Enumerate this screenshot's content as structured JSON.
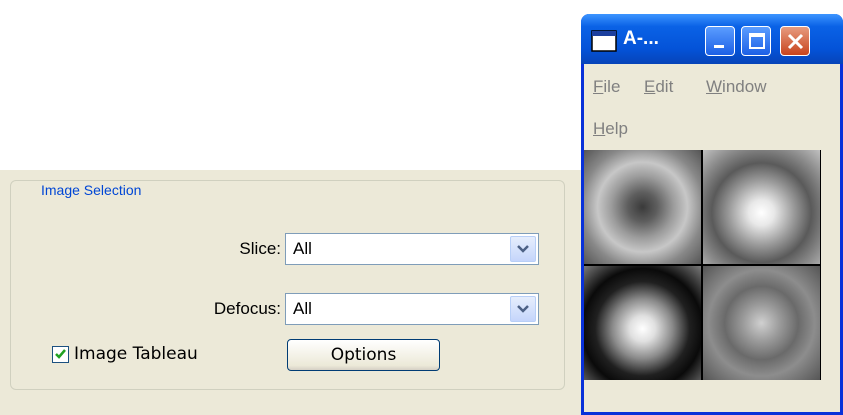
{
  "image_selection": {
    "group_title": "Image Selection",
    "slice": {
      "label": "Slice:",
      "value": "All"
    },
    "defocus": {
      "label": "Defocus:",
      "value": "All"
    },
    "image_tableau": {
      "label": "Image Tableau",
      "checked": true
    },
    "options_button": "Options"
  },
  "window": {
    "title": "A-...",
    "menu": [
      {
        "label": "File",
        "mnemonic": "F"
      },
      {
        "label": "Edit",
        "mnemonic": "E"
      },
      {
        "label": "Window",
        "mnemonic": "W"
      },
      {
        "label": "Help",
        "mnemonic": "H"
      }
    ],
    "colors": {
      "titlebar": "#0453d8",
      "close_button": "#c8441d"
    }
  }
}
